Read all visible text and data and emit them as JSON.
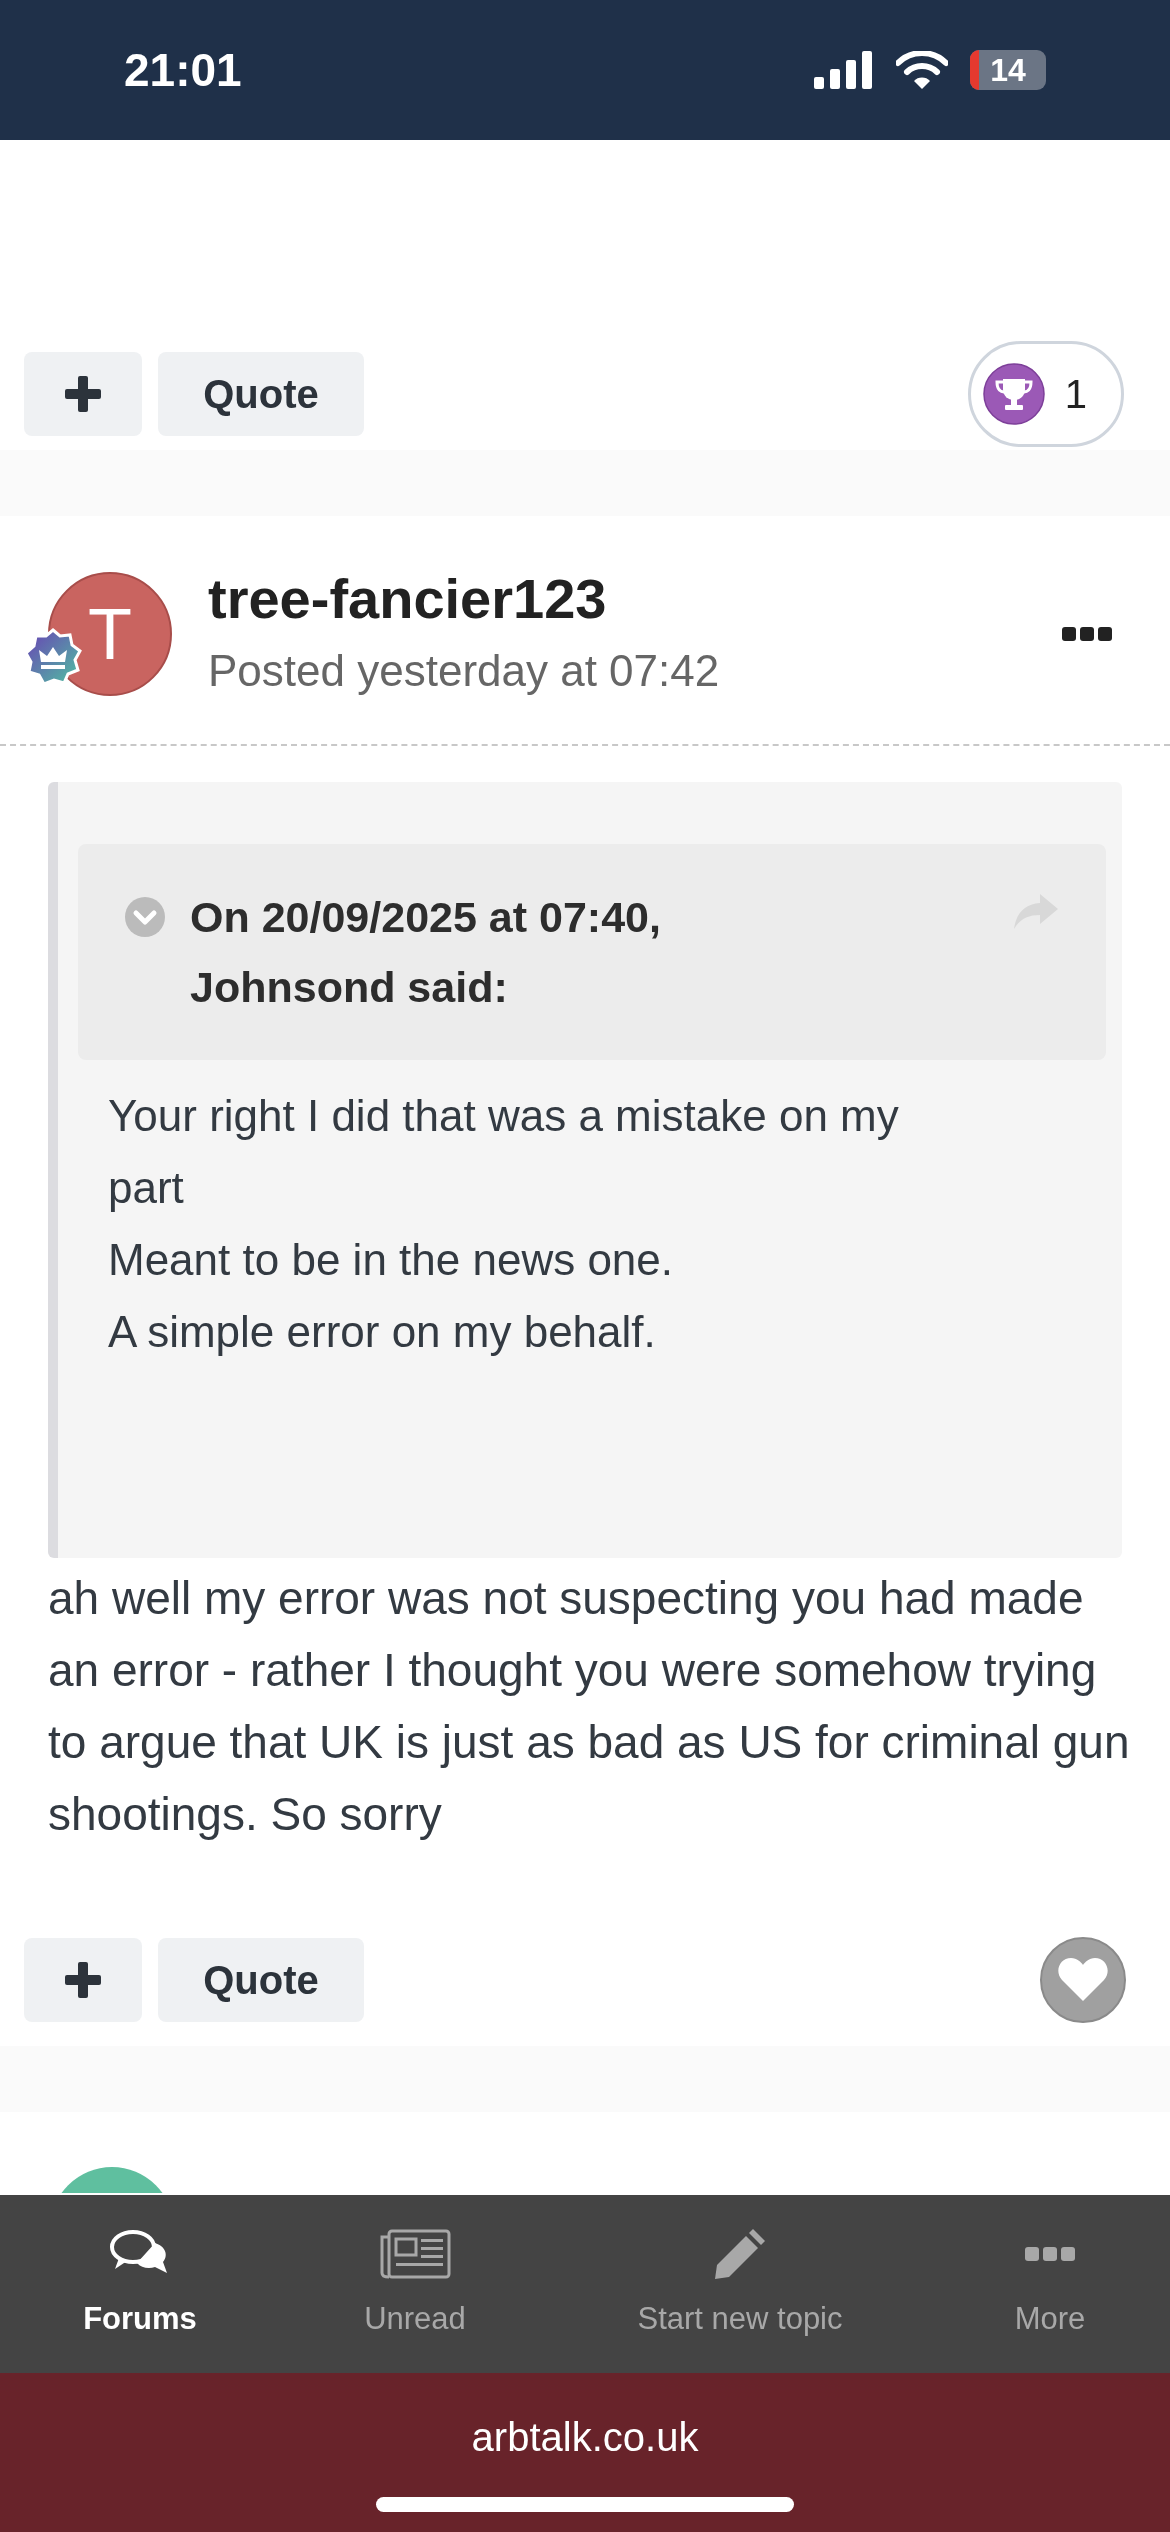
{
  "status_bar": {
    "time": "21:01",
    "battery": "14"
  },
  "top_actions": {
    "quote_label": "Quote",
    "reaction": {
      "kind": "count",
      "count": "1"
    }
  },
  "post": {
    "author": "tree-fancier123",
    "avatar_letter": "T",
    "posted": "Posted yesterday at 07:42",
    "quote": {
      "header": "On 20/09/2025 at 07:40, Johnsond said:",
      "lines": [
        "Your right I did that was a mistake on my part",
        "Meant to be in the news one.",
        "A simple error on my behalf."
      ]
    },
    "body": "ah well my error was not suspecting you had made an error - rather I thought you were somehow trying to argue that UK is just as bad as US for criminal gun shootings. So sorry",
    "actions": {
      "quote_label": "Quote",
      "reaction": {
        "kind": "like"
      }
    }
  },
  "nav": [
    {
      "label": "Forums",
      "selected": true
    },
    {
      "label": "Unread",
      "selected": false
    },
    {
      "label": "Start new topic",
      "selected": false
    },
    {
      "label": "More",
      "selected": false
    }
  ],
  "browser_bar": {
    "url": "arbtalk.co.uk"
  }
}
